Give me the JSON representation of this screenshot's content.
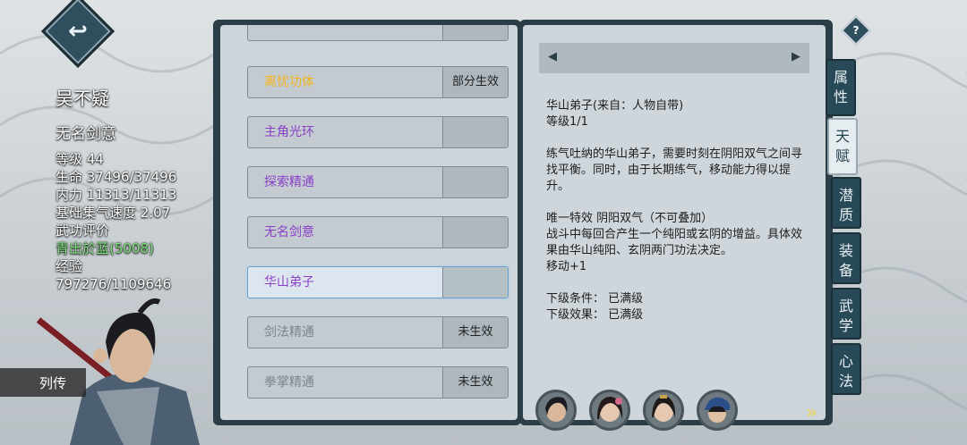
{
  "header": {
    "back_icon": "return-arrow-icon",
    "help_label": "?"
  },
  "character": {
    "name": "吴不疑",
    "title": "无名剑意",
    "level": "等级 44",
    "hp": "生命 37496/37496",
    "mp": "内力 11313/11313",
    "qi_speed": "基础集气速度 2.07",
    "rating_label": "武功评价",
    "rating_value": "青出於蓝(5008)",
    "exp_label": "经验",
    "exp_value": "797276/1109646"
  },
  "liezhuan_label": "列传",
  "talents": [
    {
      "label": "离忧功体",
      "status": "部分生效",
      "color": "#f3b51c"
    },
    {
      "label": "主角光环",
      "status": "",
      "color": "#8a3fc9"
    },
    {
      "label": "探索精通",
      "status": "",
      "color": "#8a3fc9"
    },
    {
      "label": "无名剑意",
      "status": "",
      "color": "#8a3fc9"
    },
    {
      "label": "华山弟子",
      "status": "",
      "color": "#8a3fc9",
      "selected": true
    },
    {
      "label": "剑法精通",
      "status": "未生效",
      "color": "#7b858b"
    },
    {
      "label": "拳掌精通",
      "status": "未生效",
      "color": "#7b858b"
    }
  ],
  "detail": {
    "nav_prev": "◀",
    "nav_next": "▶",
    "line1": "华山弟子(来自：人物自带)",
    "line2": "等级1/1",
    "desc": "练气吐纳的华山弟子，需要时刻在阴阳双气之间寻找平衡。同时，由于长期练气，移动能力得以提升。",
    "effect_title": "唯一特效 阴阳双气（不可叠加）",
    "effect_desc": "战斗中每回合产生一个纯阳或玄阴的增益。具体效果由华山纯阳、玄阴两门功法决定。",
    "effect_move": "移动+1",
    "next_cond": "下级条件：  已满级",
    "next_effect": "下级效果：  已满级"
  },
  "tabs": [
    "属性",
    "天赋",
    "潜质",
    "装备",
    "武学",
    "心法"
  ],
  "active_tab": "天赋",
  "next_arrow": "»"
}
